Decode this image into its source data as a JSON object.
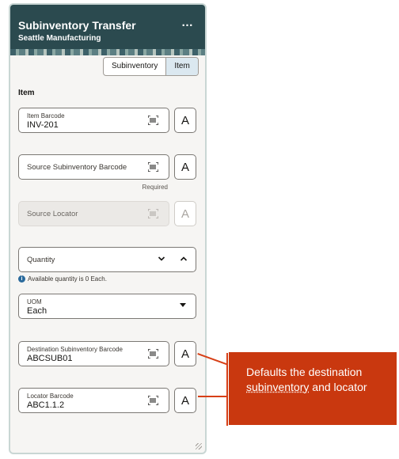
{
  "header": {
    "title": "Subinventory Transfer",
    "subtitle": "Seattle Manufacturing",
    "more_label": "…"
  },
  "segment": {
    "options": [
      "Subinventory",
      "Item"
    ],
    "selected": "Item"
  },
  "section_title": "Item",
  "fields": {
    "item_barcode": {
      "label": "Item Barcode",
      "value": "INV-201"
    },
    "source_subinventory": {
      "placeholder": "Source Subinventory Barcode",
      "helper": "Required"
    },
    "source_locator": {
      "placeholder": "Source Locator"
    },
    "quantity": {
      "placeholder": "Quantity",
      "info": "Available quantity is 0 Each."
    },
    "uom": {
      "label": "UOM",
      "value": "Each"
    },
    "destination_subinventory": {
      "label": "Destination Subinventory Barcode",
      "value": "ABCSUB01"
    },
    "locator_barcode": {
      "label": "Locator Barcode",
      "value": "ABC1.1.2"
    }
  },
  "side_button_glyph": "A",
  "callout": {
    "line1": "Defaults the destination",
    "underlined": "subinventory",
    "line2_rest": " and locator"
  },
  "colors": {
    "header": "#2b4a4f",
    "callout": "#c9380f",
    "selected_segment": "#dbe8f0"
  }
}
